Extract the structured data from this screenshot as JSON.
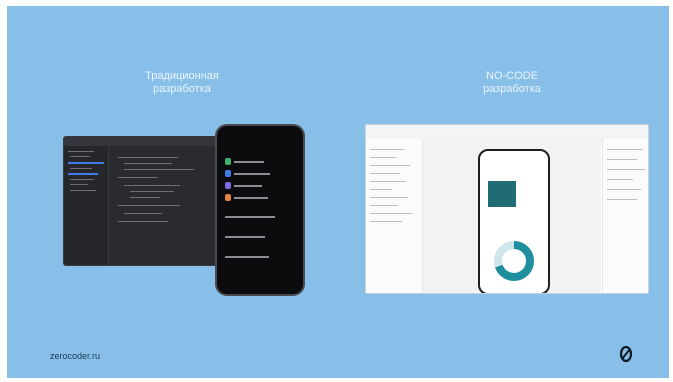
{
  "slide": {
    "background": "#87bfe9",
    "left_heading": [
      "Традиционная",
      "разработка"
    ],
    "right_heading": [
      "NO-CODE",
      "разработка"
    ],
    "footer_url": "zerocoder.ru"
  },
  "icons": {
    "logo": "zerocoder-logo-icon"
  },
  "colors": {
    "accent_teal": "#1f6c75",
    "ide_highlight": "#3f7be6"
  }
}
